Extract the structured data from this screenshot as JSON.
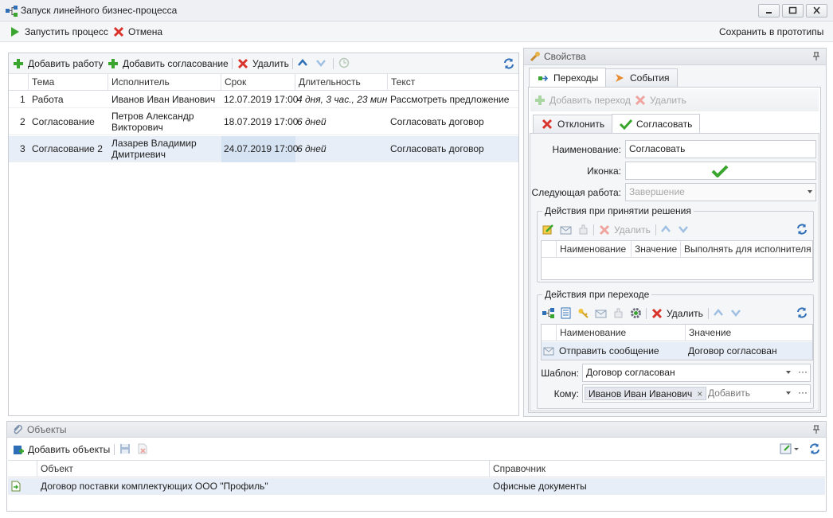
{
  "window": {
    "title": "Запуск линейного бизнес-процесса"
  },
  "toolbar": {
    "start_label": "Запустить процесс",
    "cancel_label": "Отмена",
    "save_proto_label": "Сохранить в прототипы"
  },
  "works": {
    "toolbar": {
      "add_work": "Добавить работу",
      "add_approval": "Добавить согласование",
      "delete": "Удалить"
    },
    "columns": [
      "Тема",
      "Исполнитель",
      "Срок",
      "Длительность",
      "Текст"
    ],
    "rows": [
      {
        "num": "1",
        "theme": "Работа",
        "executor_line1": "Иванов Иван Иванович",
        "executor_line2": "",
        "deadline": "12.07.2019 17:00",
        "duration": "4 дня, 3 час., 23 мин.",
        "text": "Рассмотреть предложение"
      },
      {
        "num": "2",
        "theme": "Согласование",
        "executor_line1": "Петров Александр",
        "executor_line2": "Викторович",
        "deadline": "18.07.2019 17:00",
        "duration": "6 дней",
        "text": "Согласовать договор"
      },
      {
        "num": "3",
        "theme": "Согласование 2",
        "executor_line1": "Лазарев Владимир",
        "executor_line2": "Дмитриевич",
        "deadline": "24.07.2019 17:00",
        "duration": "6 дней",
        "text": "Согласовать договор"
      }
    ]
  },
  "properties": {
    "title": "Свойства",
    "tabs": [
      "Переходы",
      "События"
    ],
    "add_transition": "Добавить переход",
    "delete": "Удалить",
    "subtabs": [
      "Отклонить",
      "Согласовать"
    ],
    "name_label": "Наименование:",
    "name_value": "Согласовать",
    "icon_label": "Иконка:",
    "next_work_label": "Следующая работа:",
    "next_work_value": "Завершение",
    "decision_group": {
      "title": "Действия при принятии решения",
      "delete": "Удалить",
      "columns": [
        "Наименование",
        "Значение",
        "Выполнять для исполнителя"
      ]
    },
    "transition_group": {
      "title": "Действия при переходе",
      "delete": "Удалить",
      "columns": [
        "Наименование",
        "Значение"
      ],
      "rows": [
        {
          "name": "Отправить сообщение",
          "value": "Договор согласован"
        }
      ]
    },
    "template_label": "Шаблон:",
    "template_value": "Договор согласован",
    "to_label": "Кому:",
    "to_chip": "Иванов Иван Иванович",
    "to_placeholder": "Добавить"
  },
  "objects": {
    "title": "Объекты",
    "add_objects": "Добавить объекты",
    "columns": [
      "Объект",
      "Справочник"
    ],
    "rows": [
      {
        "object": "Договор поставки комплектующих ООО \"Профиль\"",
        "directory": "Офисные документы"
      }
    ]
  },
  "colors": {
    "accent": "#2e6fb7",
    "selected_row": "#e7eef7",
    "green_check": "#3aa52f",
    "red_x": "#d9342b"
  }
}
